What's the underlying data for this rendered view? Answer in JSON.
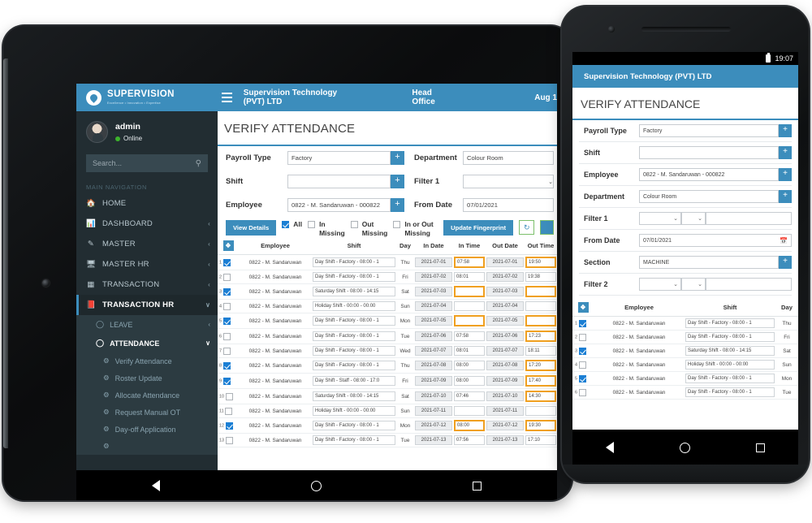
{
  "tablet": {
    "topbar": {
      "menu_icon": "hamburger-icon",
      "title": "Supervision Technology (PVT) LTD",
      "office": "Head Office",
      "date": "Aug 1"
    },
    "sidebar": {
      "logo_text": "SUPERVISION",
      "logo_sub": "Excellence • Innovation • Expertise",
      "user_name": "admin",
      "user_status": "Online",
      "search_placeholder": "Search...",
      "search_icon": "search-icon",
      "section_label": "MAIN NAVIGATION",
      "items": [
        {
          "label": "HOME",
          "icon": "home-icon",
          "caret": ""
        },
        {
          "label": "DASHBOARD",
          "icon": "chart-bar-icon",
          "caret": "‹"
        },
        {
          "label": "MASTER",
          "icon": "edit-icon",
          "caret": "‹"
        },
        {
          "label": "MASTER HR",
          "icon": "monitor-icon",
          "caret": "‹"
        },
        {
          "label": "TRANSACTION",
          "icon": "grid-icon",
          "caret": "‹"
        },
        {
          "label": "TRANSACTION HR",
          "icon": "book-icon",
          "caret": "∨"
        }
      ],
      "sub_items": [
        {
          "label": "LEAVE",
          "icon": "circle-icon",
          "caret": "‹"
        },
        {
          "label": "ATTENDANCE",
          "icon": "circle-filled-icon",
          "caret": "∨"
        }
      ],
      "sub2_items": [
        {
          "label": "Verify Attendance",
          "icon": "gear-icon"
        },
        {
          "label": "Roster Update",
          "icon": "gear-icon"
        },
        {
          "label": "Allocate Attendance",
          "icon": "gear-icon"
        },
        {
          "label": "Request Manual OT",
          "icon": "gear-icon"
        },
        {
          "label": "Day-off Application",
          "icon": "gear-icon"
        }
      ]
    },
    "page": {
      "title": "VERIFY ATTENDANCE",
      "form": {
        "payroll_type_label": "Payroll Type",
        "payroll_type_value": "Factory",
        "shift_label": "Shift",
        "shift_value": "",
        "employee_label": "Employee",
        "employee_value": "0822 - M. Sandaruwan - 000822",
        "department_label": "Department",
        "department_value": "Colour Room",
        "filter1_label": "Filter 1",
        "filter1_value": "",
        "fromdate_label": "From Date",
        "fromdate_value": "07/01/2021"
      },
      "actions": {
        "view_details": "View Details",
        "all_label": "All",
        "in_missing_label": "In Missing",
        "out_missing_label": "Out Missing",
        "in_or_out_missing_label": "In or Out Missing",
        "update_fingerprint": "Update Fingerprint",
        "refresh_icon": "refresh-icon"
      },
      "table": {
        "select_all_icon": "expand-icon",
        "columns": [
          "Employee",
          "Shift",
          "Day",
          "In Date",
          "In Time",
          "Out Date",
          "Out Time"
        ],
        "rows": [
          {
            "n": "1",
            "checked": true,
            "employee": "0822 - M. Sandaruwan",
            "shift": "Day Shift - Factory - 08:00 - 1",
            "day": "Thu",
            "in_date": "2021-07-01",
            "in_time": "07:58",
            "in_hl": true,
            "out_date": "2021-07-01",
            "out_time": "19:50",
            "out_hl": true
          },
          {
            "n": "2",
            "checked": false,
            "employee": "0822 - M. Sandaruwan",
            "shift": "Day Shift - Factory - 08:00 - 1",
            "day": "Fri",
            "in_date": "2021-07-02",
            "in_time": "08:01",
            "in_hl": false,
            "out_date": "2021-07-02",
            "out_time": "19:38",
            "out_hl": false
          },
          {
            "n": "3",
            "checked": true,
            "employee": "0822 - M. Sandaruwan",
            "shift": "Saturday Shift - 08:00 - 14:15",
            "day": "Sat",
            "in_date": "2021-07-03",
            "in_time": "",
            "in_hl": true,
            "out_date": "2021-07-03",
            "out_time": "",
            "out_hl": true
          },
          {
            "n": "4",
            "checked": false,
            "employee": "0822 - M. Sandaruwan",
            "shift": "Holiday Shift - 00:00 - 00:00",
            "day": "Sun",
            "in_date": "2021-07-04",
            "in_time": "",
            "in_hl": false,
            "out_date": "2021-07-04",
            "out_time": "",
            "out_hl": false
          },
          {
            "n": "5",
            "checked": true,
            "employee": "0822 - M. Sandaruwan",
            "shift": "Day Shift - Factory - 08:00 - 1",
            "day": "Mon",
            "in_date": "2021-07-05",
            "in_time": "",
            "in_hl": true,
            "out_date": "2021-07-05",
            "out_time": "",
            "out_hl": true
          },
          {
            "n": "6",
            "checked": false,
            "employee": "0822 - M. Sandaruwan",
            "shift": "Day Shift - Factory - 08:00 - 1",
            "day": "Tue",
            "in_date": "2021-07-06",
            "in_time": "07:58",
            "in_hl": false,
            "out_date": "2021-07-06",
            "out_time": "17:23",
            "out_hl": true
          },
          {
            "n": "7",
            "checked": false,
            "employee": "0822 - M. Sandaruwan",
            "shift": "Day Shift - Factory - 08:00 - 1",
            "day": "Wed",
            "in_date": "2021-07-07",
            "in_time": "08:01",
            "in_hl": false,
            "out_date": "2021-07-07",
            "out_time": "18:11",
            "out_hl": false
          },
          {
            "n": "8",
            "checked": true,
            "employee": "0822 - M. Sandaruwan",
            "shift": "Day Shift - Factory - 08:00 - 1",
            "day": "Thu",
            "in_date": "2021-07-08",
            "in_time": "08:00",
            "in_hl": false,
            "out_date": "2021-07-08",
            "out_time": "17:20",
            "out_hl": true
          },
          {
            "n": "9",
            "checked": true,
            "employee": "0822 - M. Sandaruwan",
            "shift": "Day Shift - Staff - 08:00 - 17:0",
            "day": "Fri",
            "in_date": "2021-07-09",
            "in_time": "08:00",
            "in_hl": false,
            "out_date": "2021-07-09",
            "out_time": "17:40",
            "out_hl": true
          },
          {
            "n": "10",
            "checked": false,
            "employee": "0822 - M. Sandaruwan",
            "shift": "Saturday Shift - 08:00 - 14:15",
            "day": "Sat",
            "in_date": "2021-07-10",
            "in_time": "07:46",
            "in_hl": false,
            "out_date": "2021-07-10",
            "out_time": "14:30",
            "out_hl": true
          },
          {
            "n": "11",
            "checked": false,
            "employee": "0822 - M. Sandaruwan",
            "shift": "Holiday Shift - 00:00 - 00:00",
            "day": "Sun",
            "in_date": "2021-07-11",
            "in_time": "",
            "in_hl": false,
            "out_date": "2021-07-11",
            "out_time": "",
            "out_hl": false
          },
          {
            "n": "12",
            "checked": true,
            "employee": "0822 - M. Sandaruwan",
            "shift": "Day Shift - Factory - 08:00 - 1",
            "day": "Mon",
            "in_date": "2021-07-12",
            "in_time": "08:00",
            "in_hl": true,
            "out_date": "2021-07-12",
            "out_time": "19:30",
            "out_hl": true
          },
          {
            "n": "13",
            "checked": false,
            "employee": "0822 - M. Sandaruwan",
            "shift": "Day Shift - Factory - 08:00 - 1",
            "day": "Tue",
            "in_date": "2021-07-13",
            "in_time": "07:56",
            "in_hl": false,
            "out_date": "2021-07-13",
            "out_time": "17:10",
            "out_hl": false
          }
        ]
      }
    },
    "android_nav": {
      "back": "back-icon",
      "home": "home-circle-icon",
      "recents": "recents-icon"
    }
  },
  "phone": {
    "statusbar": {
      "battery_icon": "battery-icon",
      "time": "19:07"
    },
    "topbar": {
      "menu_icon": "hamburger-icon",
      "title": "Supervision Technology (PVT) LTD"
    },
    "page": {
      "title": "VERIFY ATTENDANCE",
      "form": [
        {
          "label": "Payroll Type",
          "value": "Factory",
          "type": "plus"
        },
        {
          "label": "Shift",
          "value": "",
          "type": "plus"
        },
        {
          "label": "Employee",
          "value": "0822 - M. Sandaruwan - 000822",
          "type": "plus"
        },
        {
          "label": "Department",
          "value": "Colour Room",
          "type": "plus"
        },
        {
          "label": "Filter 1",
          "value": "",
          "type": "filter"
        },
        {
          "label": "From Date",
          "value": "07/01/2021",
          "type": "date"
        },
        {
          "label": "Section",
          "value": "MACHINE",
          "type": "plus"
        },
        {
          "label": "Filter 2",
          "value": "",
          "type": "filter"
        }
      ],
      "table": {
        "select_all_icon": "expand-icon",
        "columns": [
          "Employee",
          "Shift",
          "Day"
        ],
        "rows": [
          {
            "n": "1",
            "checked": true,
            "employee": "0822 - M. Sandaruwan",
            "shift": "Day Shift - Factory - 08:00 - 1",
            "day": "Thu"
          },
          {
            "n": "2",
            "checked": false,
            "employee": "0822 - M. Sandaruwan",
            "shift": "Day Shift - Factory - 08:00 - 1",
            "day": "Fri"
          },
          {
            "n": "3",
            "checked": true,
            "employee": "0822 - M. Sandaruwan",
            "shift": "Saturday Shift - 08:00 - 14:15",
            "day": "Sat"
          },
          {
            "n": "4",
            "checked": false,
            "employee": "0822 - M. Sandaruwan",
            "shift": "Holiday Shift - 00:00 - 00:00",
            "day": "Sun"
          },
          {
            "n": "5",
            "checked": true,
            "employee": "0822 - M. Sandaruwan",
            "shift": "Day Shift - Factory - 08:00 - 1",
            "day": "Mon"
          },
          {
            "n": "6",
            "checked": false,
            "employee": "0822 - M. Sandaruwan",
            "shift": "Day Shift - Factory - 08:00 - 1",
            "day": "Tue"
          }
        ]
      }
    },
    "android_nav": {
      "back": "back-icon",
      "home": "home-circle-icon",
      "recents": "recents-icon"
    }
  },
  "colors": {
    "brand_blue": "#3c8dbc",
    "sidebar_dark": "#222d32",
    "highlight_orange": "#f0a020",
    "online_green": "#3cb42c",
    "checkbox_blue": "#1b7fd4"
  }
}
